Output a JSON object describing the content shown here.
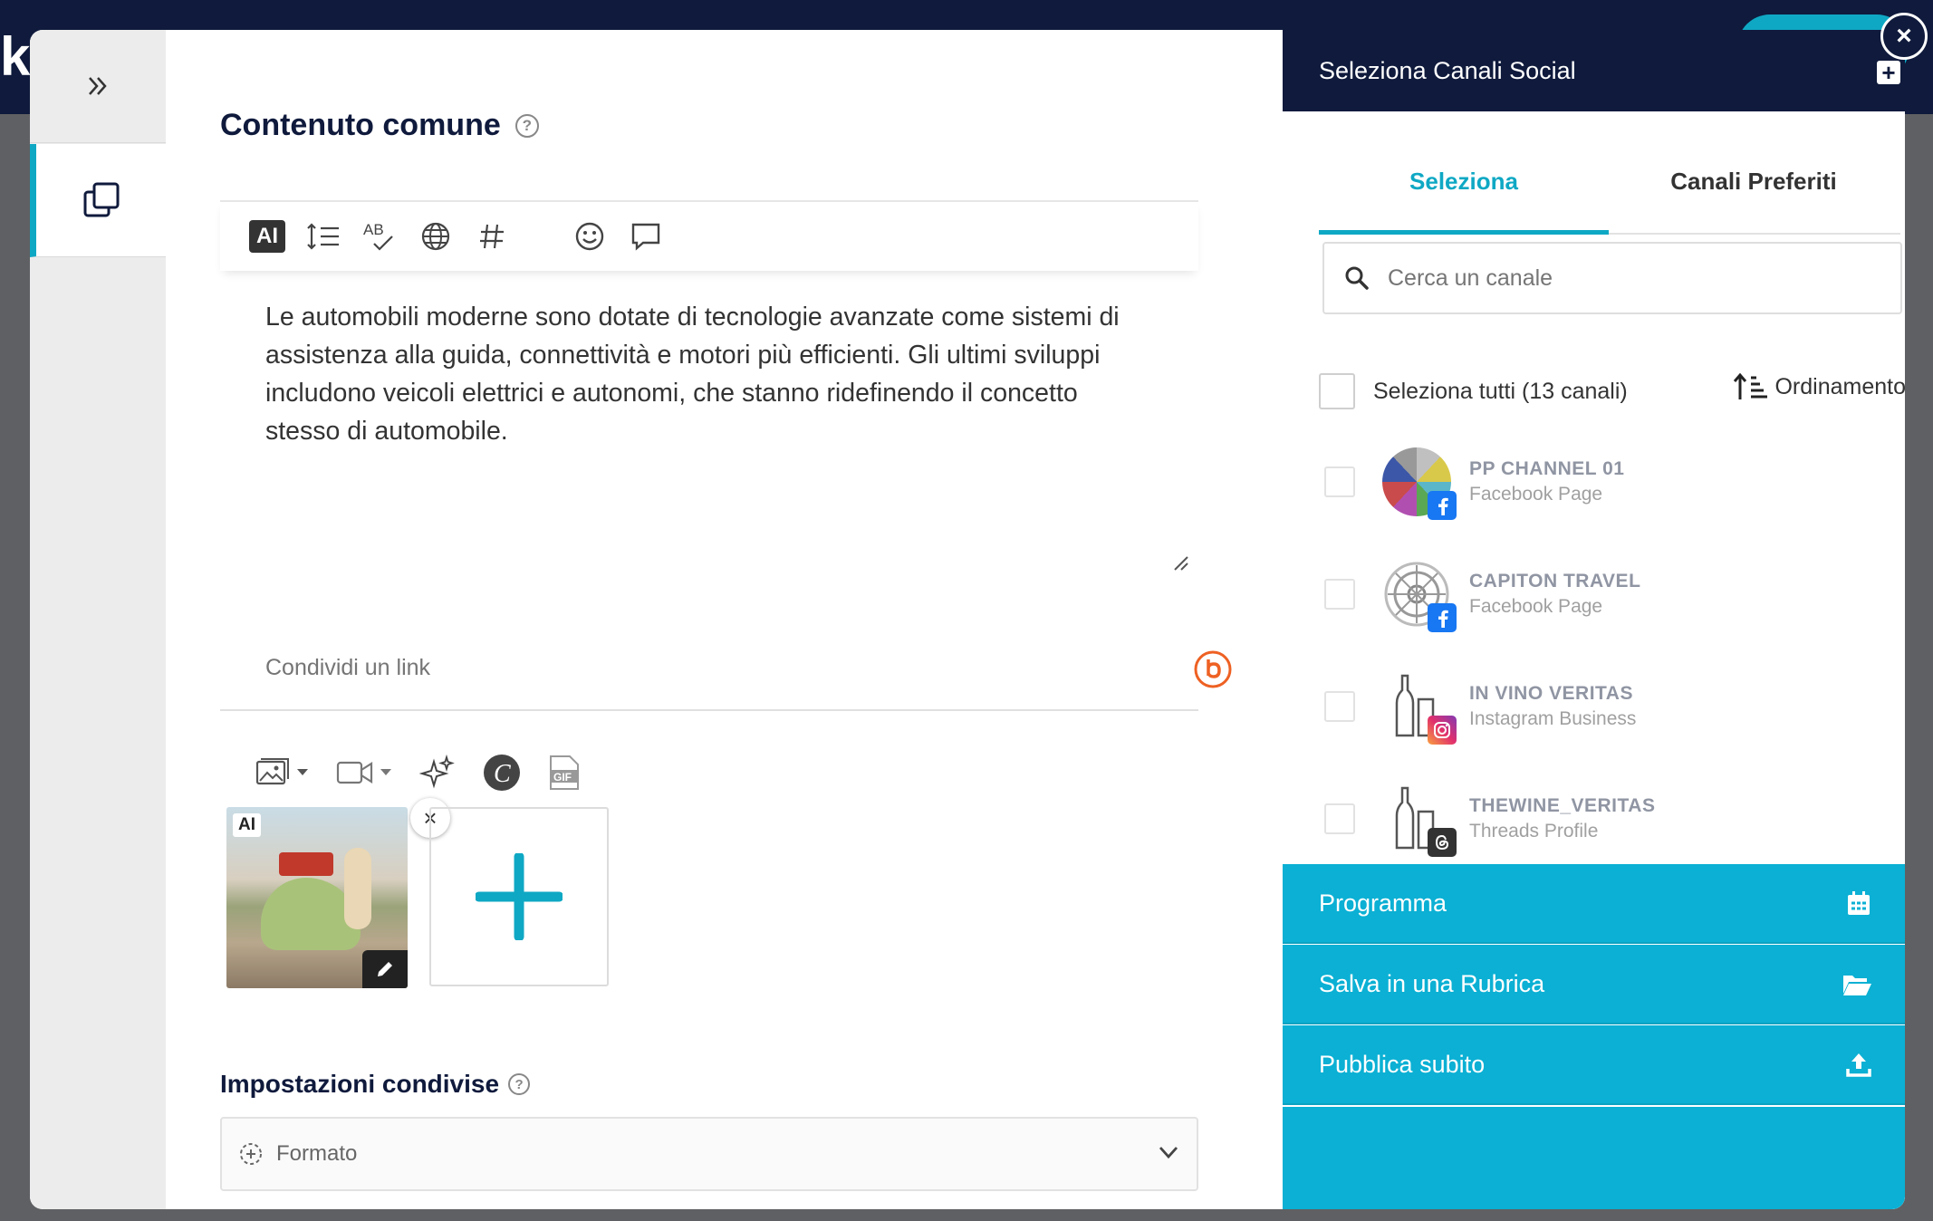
{
  "background": {
    "logo": "k"
  },
  "editor": {
    "title": "Contenuto comune",
    "help": "?",
    "toolbar": {
      "ai": "AI",
      "ab": "AB"
    },
    "text": "Le automobili moderne sono dotate di tecnologie avanzate come sistemi di assistenza alla guida, connettività e motori più efficienti. Gli ultimi sviluppi includono veicoli elettrici e autonomi, che stanno ridefinendo il concetto stesso di automobile.",
    "link_placeholder": "Condividi un link",
    "media": {
      "ai_badge": "AI",
      "remove": "×",
      "gif": "GIF",
      "canva": "C"
    },
    "shared_settings_title": "Impostazioni condivise",
    "formato_label": "Formato"
  },
  "panel": {
    "title": "Seleziona Canali Social",
    "add": "+",
    "tabs": [
      "Seleziona",
      "Canali Preferiti"
    ],
    "search_placeholder": "Cerca un canale",
    "select_all": "Seleziona tutti (13 canali)",
    "sort_label": "Ordinamento",
    "channels": [
      {
        "name": "PP CHANNEL 01",
        "type": "Facebook Page",
        "network": "facebook",
        "color": "#1877f2"
      },
      {
        "name": "CAPITON TRAVEL",
        "type": "Facebook Page",
        "network": "facebook",
        "color": "#1877f2"
      },
      {
        "name": "IN VINO VERITAS",
        "type": "Instagram Business",
        "network": "instagram",
        "color": "#e1306c"
      },
      {
        "name": "THEWINE_VERITAS",
        "type": "Threads Profile",
        "network": "threads",
        "color": "#333333"
      }
    ],
    "actions": [
      "Programma",
      "Salva in una Rubrica",
      "Pubblica subito"
    ]
  },
  "close": "×",
  "colors": {
    "accent": "#0fa8c4",
    "navy": "#0f1a3c",
    "action": "#0bb0d4"
  }
}
